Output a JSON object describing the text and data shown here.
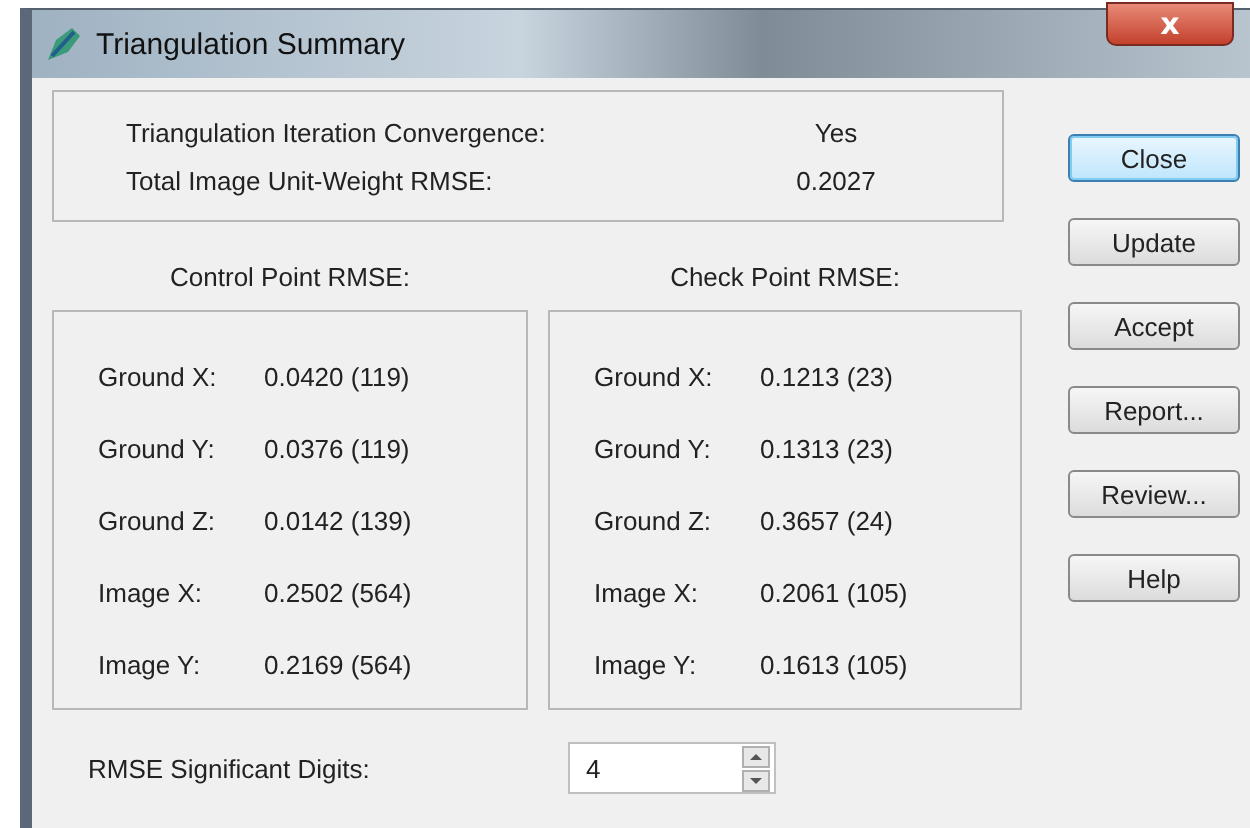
{
  "window": {
    "title": "Triangulation Summary",
    "close_glyph": "x"
  },
  "summary": [
    {
      "label": "Triangulation Iteration Convergence:",
      "value": "Yes"
    },
    {
      "label": "Total Image Unit-Weight RMSE:",
      "value": "0.2027"
    }
  ],
  "panels": [
    {
      "heading": "Control Point RMSE:",
      "rows": [
        {
          "label": "Ground X:",
          "value": "0.0420 (119)"
        },
        {
          "label": "Ground Y:",
          "value": "0.0376 (119)"
        },
        {
          "label": "Ground Z:",
          "value": "0.0142 (139)"
        },
        {
          "label": "Image X:",
          "value": "0.2502 (564)"
        },
        {
          "label": "Image Y:",
          "value": "0.2169 (564)"
        }
      ]
    },
    {
      "heading": "Check Point RMSE:",
      "rows": [
        {
          "label": "Ground X:",
          "value": "0.1213 (23)"
        },
        {
          "label": "Ground Y:",
          "value": "0.1313 (23)"
        },
        {
          "label": "Ground Z:",
          "value": "0.3657 (24)"
        },
        {
          "label": "Image X:",
          "value": "0.2061 (105)"
        },
        {
          "label": "Image Y:",
          "value": "0.1613 (105)"
        }
      ]
    }
  ],
  "buttons": [
    {
      "label": "Close",
      "focused": true
    },
    {
      "label": "Update",
      "focused": false
    },
    {
      "label": "Accept",
      "focused": false
    },
    {
      "label": "Report...",
      "focused": false
    },
    {
      "label": "Review...",
      "focused": false
    },
    {
      "label": "Help",
      "focused": false
    }
  ],
  "digits": {
    "label": "RMSE Significant Digits:",
    "value": "4"
  }
}
